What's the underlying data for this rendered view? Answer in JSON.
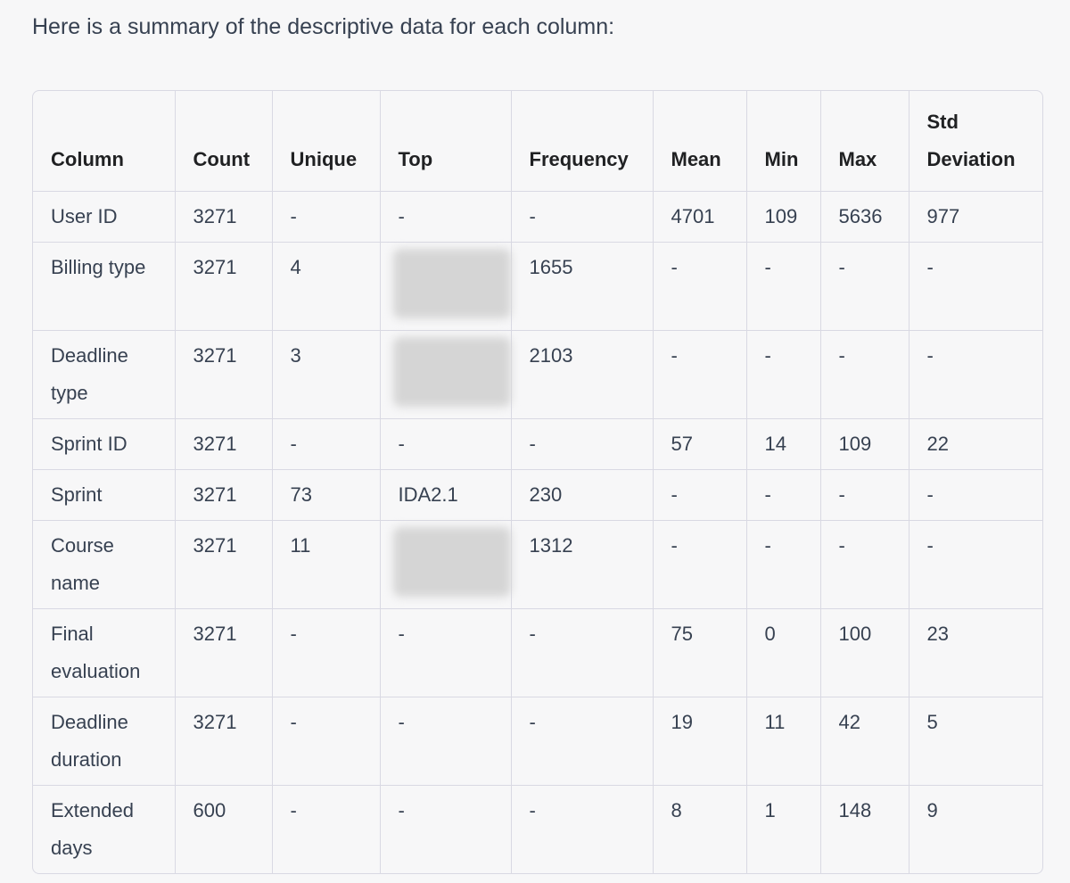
{
  "intro_text": "Here is a summary of the descriptive data for each column:",
  "table": {
    "headers": [
      "Column",
      "Count",
      "Unique",
      "Top",
      "Frequency",
      "Mean",
      "Min",
      "Max",
      "Std Deviation"
    ],
    "rows": [
      {
        "column": "User ID",
        "count": "3271",
        "unique": "-",
        "top": "-",
        "frequency": "-",
        "mean": "4701",
        "min": "109",
        "max": "5636",
        "std": "977",
        "top_redacted": false
      },
      {
        "column": "Billing type",
        "count": "3271",
        "unique": "4",
        "top": "",
        "frequency": "1655",
        "mean": "-",
        "min": "-",
        "max": "-",
        "std": "-",
        "top_redacted": true
      },
      {
        "column": "Deadline type",
        "count": "3271",
        "unique": "3",
        "top": "",
        "frequency": "2103",
        "mean": "-",
        "min": "-",
        "max": "-",
        "std": "-",
        "top_redacted": true
      },
      {
        "column": "Sprint ID",
        "count": "3271",
        "unique": "-",
        "top": "-",
        "frequency": "-",
        "mean": "57",
        "min": "14",
        "max": "109",
        "std": "22",
        "top_redacted": false
      },
      {
        "column": "Sprint",
        "count": "3271",
        "unique": "73",
        "top": "IDA2.1",
        "frequency": "230",
        "mean": "-",
        "min": "-",
        "max": "-",
        "std": "-",
        "top_redacted": false
      },
      {
        "column": "Course name",
        "count": "3271",
        "unique": "11",
        "top": "",
        "frequency": "1312",
        "mean": "-",
        "min": "-",
        "max": "-",
        "std": "-",
        "top_redacted": true
      },
      {
        "column": "Final evaluation",
        "count": "3271",
        "unique": "-",
        "top": "-",
        "frequency": "-",
        "mean": "75",
        "min": "0",
        "max": "100",
        "std": "23",
        "top_redacted": false
      },
      {
        "column": "Deadline duration",
        "count": "3271",
        "unique": "-",
        "top": "-",
        "frequency": "-",
        "mean": "19",
        "min": "11",
        "max": "42",
        "std": "5",
        "top_redacted": false
      },
      {
        "column": "Extended days",
        "count": "600",
        "unique": "-",
        "top": "-",
        "frequency": "-",
        "mean": "8",
        "min": "1",
        "max": "148",
        "std": "9",
        "top_redacted": false
      }
    ]
  }
}
